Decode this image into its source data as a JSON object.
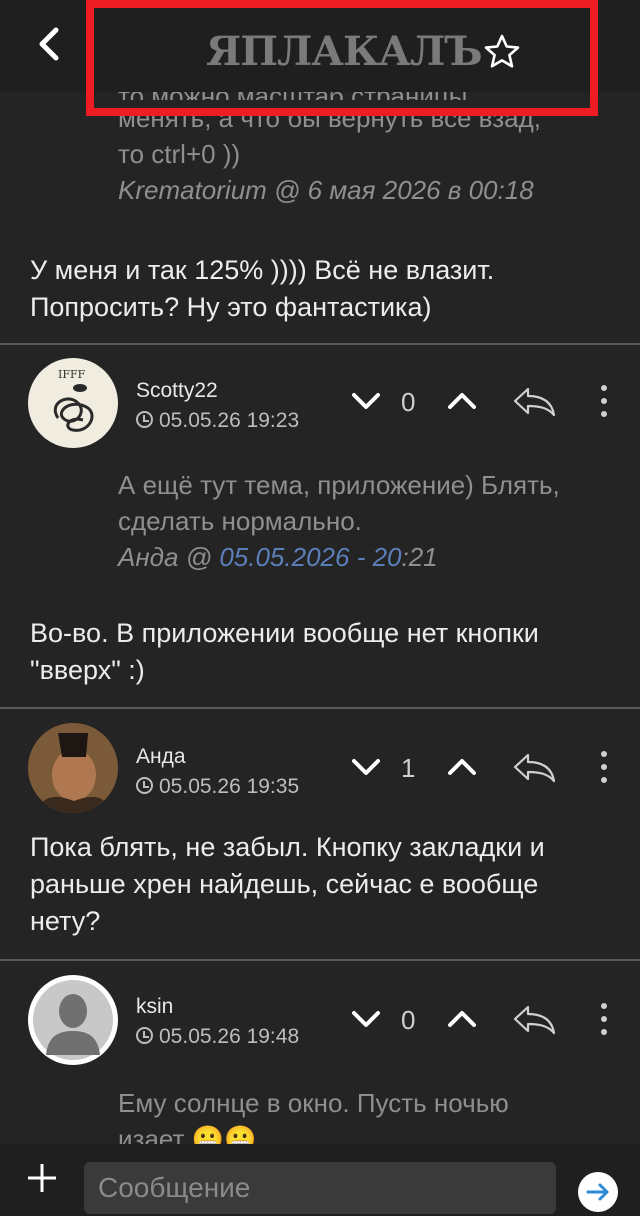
{
  "header": {
    "logo": "ЯПЛАКАЛЪ"
  },
  "first": {
    "quote_partial": "то можно масштаб страницы",
    "quote_text_1": "менять, а что бы вернуть все взад,",
    "quote_text_2": "то ctrl+0 ))",
    "quote_author": "Krematorium @ 6 мая 2026 в 00:18",
    "message_1": "У меня и так 125% )))) Всё не влазит.",
    "message_2": "Попросить? Ну это фантастика)"
  },
  "comments": [
    {
      "username": "Scotty22",
      "time": "05.05.26 19:23",
      "votes": "0",
      "quote_1": "А ещё тут тема, приложение) Блять,",
      "quote_2": "сделать нормально.",
      "quote_author": "Анда @ ",
      "quote_link_1": "05.05.2026",
      "quote_sep": " - ",
      "quote_link_2": "20",
      "quote_tail": ":21",
      "message_1": "Во-во. В приложении вообще нет кнопки",
      "message_2": "\"вверх\" :)"
    },
    {
      "username": "Анда",
      "time": "05.05.26 19:35",
      "votes": "1",
      "message_1": "Пока блять, не забыл. Кнопку закладки и",
      "message_2": "раньше хрен найдешь, сейчас е вообще",
      "message_3": "нету?"
    },
    {
      "username": "ksin",
      "time": "05.05.26 19:48",
      "votes": "0",
      "quote_1": "Ему солнце в окно. Пусть ночью",
      "quote_2": "изает 😬😬"
    }
  ],
  "composer": {
    "placeholder": "Сообщение"
  },
  "colors": {
    "accent_red": "#ee1c25",
    "link_blue": "#5a7fb8",
    "background": "#242424"
  },
  "icons": [
    "back-arrow-icon",
    "star-icon",
    "chevron-down-icon",
    "chevron-up-icon",
    "reply-icon",
    "more-vertical-icon",
    "plus-icon",
    "send-arrow-icon",
    "clock-icon"
  ]
}
